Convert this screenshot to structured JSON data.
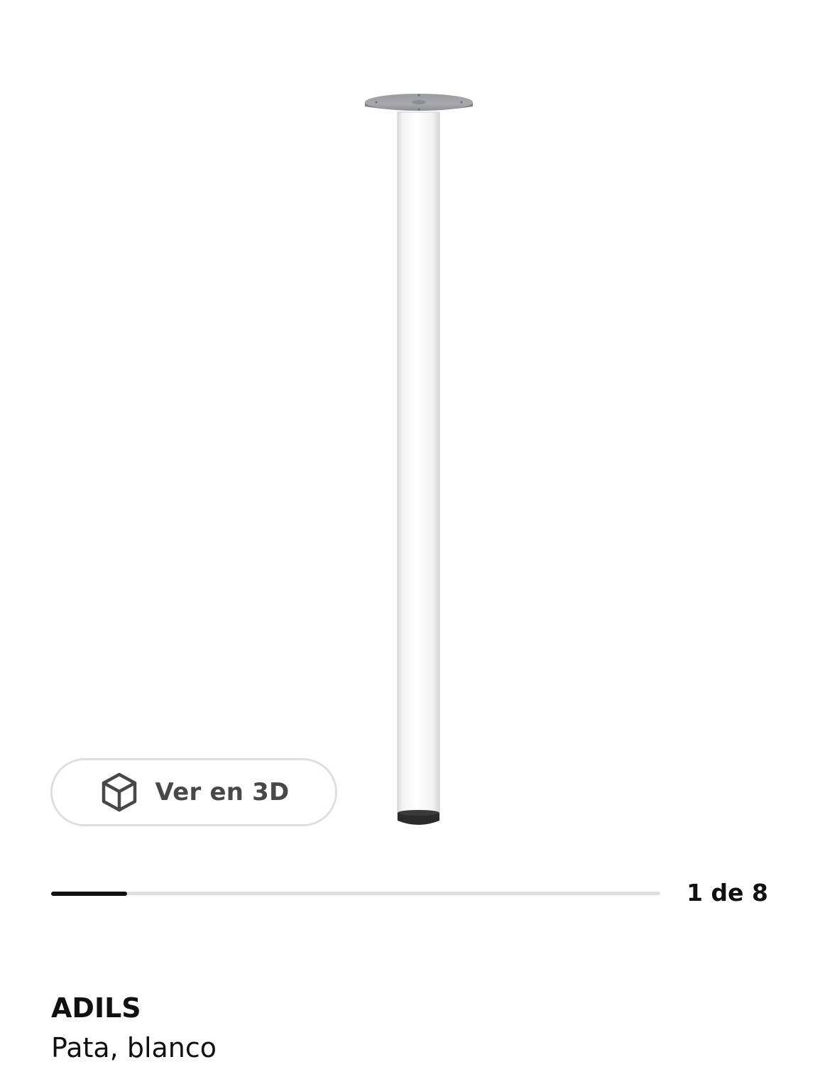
{
  "gallery": {
    "view_3d_label": "Ver en 3D",
    "view_3d_icon": "cube-3d-icon",
    "current_slide": 1,
    "total_slides": 8,
    "counter_text": "1 de 8",
    "progress_fraction": 0.125
  },
  "product": {
    "name": "ADILS",
    "description": "Pata, blanco"
  },
  "colors": {
    "text": "#111111",
    "button_text": "#484848",
    "button_border": "#dfdfdf",
    "track": "#dfdfdf",
    "fill": "#111111"
  }
}
